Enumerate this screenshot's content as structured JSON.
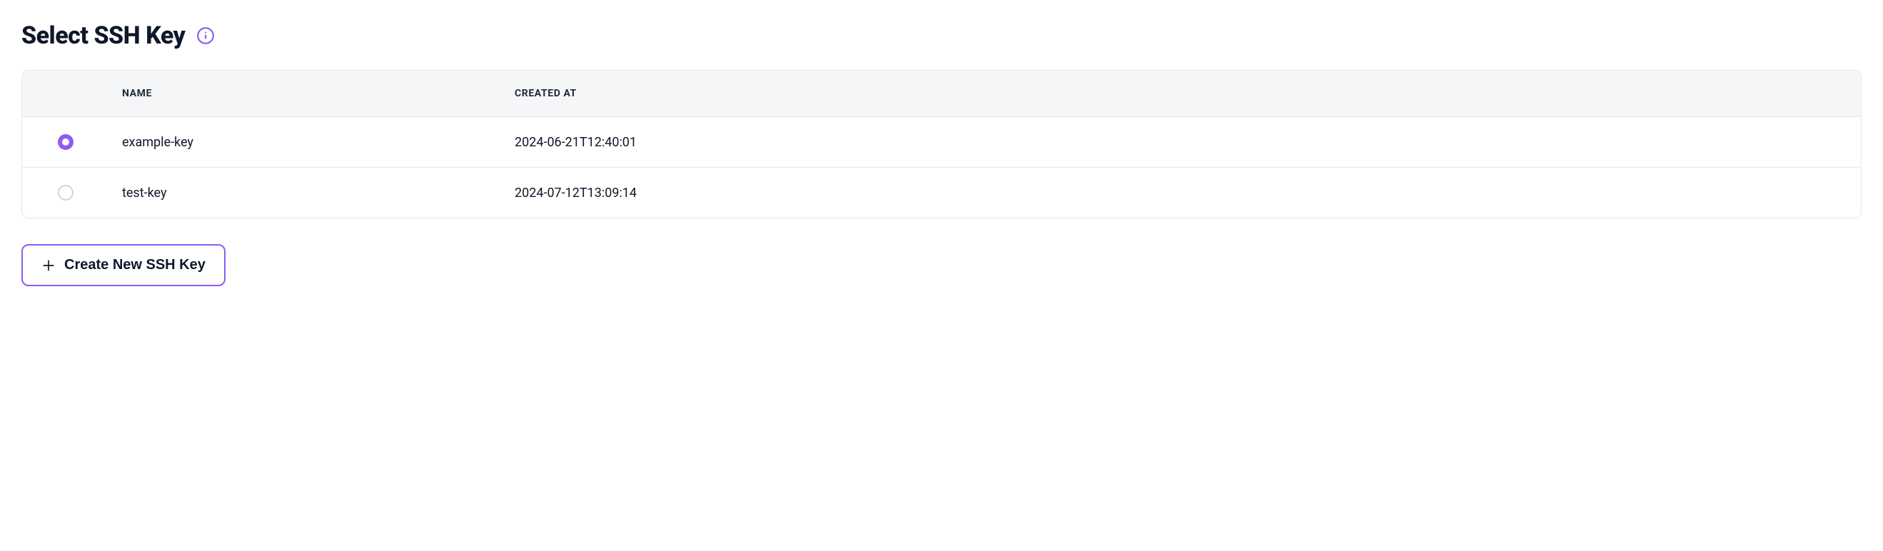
{
  "header": {
    "title": "Select SSH Key"
  },
  "table": {
    "columns": {
      "name": "Name",
      "created_at": "Created At"
    },
    "rows": [
      {
        "name": "example-key",
        "created_at": "2024-06-21T12:40:01",
        "selected": true
      },
      {
        "name": "test-key",
        "created_at": "2024-07-12T13:09:14",
        "selected": false
      }
    ]
  },
  "actions": {
    "create_new": "Create New SSH Key"
  },
  "colors": {
    "accent": "#8b5cf6"
  }
}
